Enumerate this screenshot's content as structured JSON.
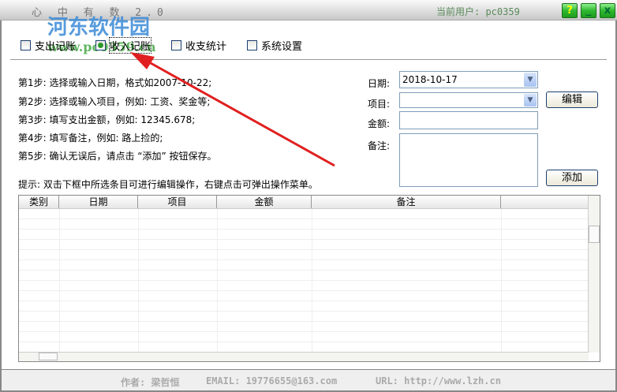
{
  "window": {
    "title": "心 中 有 数 2.0",
    "user": "当前用户: pc0359",
    "help": "?",
    "minimize": "_",
    "close": "x"
  },
  "tabs": [
    {
      "label": "支出记账",
      "checked": false
    },
    {
      "label": "收入记账",
      "checked": true
    },
    {
      "label": "收支统计",
      "checked": false
    },
    {
      "label": "系统设置",
      "checked": false
    }
  ],
  "steps": [
    "第1步: 选择或输入日期，格式如2007-10-22;",
    "第2步: 选择或输入项目，例如: 工资、奖金等;",
    "第3步: 填写支出金额，例如: 12345.678;",
    "第4步: 填写备注，例如: 路上捡的;",
    "第5步: 确认无误后，请点击 “添加” 按钮保存。"
  ],
  "hint": "提示: 双击下框中所选条目可进行编辑操作，右键点击可弹出操作菜单。",
  "form": {
    "date_label": "日期:",
    "date_value": "2018-10-17",
    "item_label": "项目:",
    "item_value": "",
    "amount_label": "金额:",
    "amount_value": "",
    "note_label": "备注:",
    "note_value": "",
    "edit_button": "编辑",
    "add_button": "添加"
  },
  "table": {
    "columns": [
      "类别",
      "日期",
      "项目",
      "金额",
      "备注",
      ""
    ],
    "rows": []
  },
  "footer": {
    "author": "作者: 梁哲恒",
    "email": "EMAIL: 19776655@163.com",
    "url": "URL: http://www.lzh.cn"
  },
  "watermark": {
    "brand": "河东软件园",
    "site": "www.pc0359.cn"
  },
  "colors": {
    "window_button": "#2fb82f",
    "annotation_arrow": "#e02020"
  }
}
